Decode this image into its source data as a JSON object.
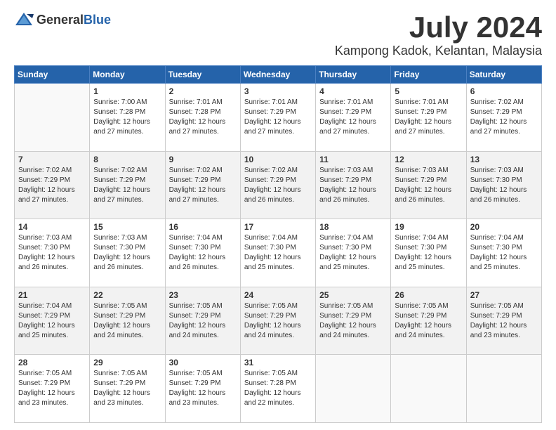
{
  "header": {
    "logo_general": "General",
    "logo_blue": "Blue",
    "month_year": "July 2024",
    "location": "Kampong Kadok, Kelantan, Malaysia"
  },
  "calendar": {
    "days_of_week": [
      "Sunday",
      "Monday",
      "Tuesday",
      "Wednesday",
      "Thursday",
      "Friday",
      "Saturday"
    ],
    "weeks": [
      [
        {
          "day": "",
          "empty": true
        },
        {
          "day": "1",
          "sunrise": "7:00 AM",
          "sunset": "7:28 PM",
          "daylight": "12 hours and 27 minutes."
        },
        {
          "day": "2",
          "sunrise": "7:01 AM",
          "sunset": "7:28 PM",
          "daylight": "12 hours and 27 minutes."
        },
        {
          "day": "3",
          "sunrise": "7:01 AM",
          "sunset": "7:29 PM",
          "daylight": "12 hours and 27 minutes."
        },
        {
          "day": "4",
          "sunrise": "7:01 AM",
          "sunset": "7:29 PM",
          "daylight": "12 hours and 27 minutes."
        },
        {
          "day": "5",
          "sunrise": "7:01 AM",
          "sunset": "7:29 PM",
          "daylight": "12 hours and 27 minutes."
        },
        {
          "day": "6",
          "sunrise": "7:02 AM",
          "sunset": "7:29 PM",
          "daylight": "12 hours and 27 minutes."
        }
      ],
      [
        {
          "day": "7",
          "sunrise": "7:02 AM",
          "sunset": "7:29 PM",
          "daylight": "12 hours and 27 minutes."
        },
        {
          "day": "8",
          "sunrise": "7:02 AM",
          "sunset": "7:29 PM",
          "daylight": "12 hours and 27 minutes."
        },
        {
          "day": "9",
          "sunrise": "7:02 AM",
          "sunset": "7:29 PM",
          "daylight": "12 hours and 27 minutes."
        },
        {
          "day": "10",
          "sunrise": "7:02 AM",
          "sunset": "7:29 PM",
          "daylight": "12 hours and 26 minutes."
        },
        {
          "day": "11",
          "sunrise": "7:03 AM",
          "sunset": "7:29 PM",
          "daylight": "12 hours and 26 minutes."
        },
        {
          "day": "12",
          "sunrise": "7:03 AM",
          "sunset": "7:29 PM",
          "daylight": "12 hours and 26 minutes."
        },
        {
          "day": "13",
          "sunrise": "7:03 AM",
          "sunset": "7:30 PM",
          "daylight": "12 hours and 26 minutes."
        }
      ],
      [
        {
          "day": "14",
          "sunrise": "7:03 AM",
          "sunset": "7:30 PM",
          "daylight": "12 hours and 26 minutes."
        },
        {
          "day": "15",
          "sunrise": "7:03 AM",
          "sunset": "7:30 PM",
          "daylight": "12 hours and 26 minutes."
        },
        {
          "day": "16",
          "sunrise": "7:04 AM",
          "sunset": "7:30 PM",
          "daylight": "12 hours and 26 minutes."
        },
        {
          "day": "17",
          "sunrise": "7:04 AM",
          "sunset": "7:30 PM",
          "daylight": "12 hours and 25 minutes."
        },
        {
          "day": "18",
          "sunrise": "7:04 AM",
          "sunset": "7:30 PM",
          "daylight": "12 hours and 25 minutes."
        },
        {
          "day": "19",
          "sunrise": "7:04 AM",
          "sunset": "7:30 PM",
          "daylight": "12 hours and 25 minutes."
        },
        {
          "day": "20",
          "sunrise": "7:04 AM",
          "sunset": "7:30 PM",
          "daylight": "12 hours and 25 minutes."
        }
      ],
      [
        {
          "day": "21",
          "sunrise": "7:04 AM",
          "sunset": "7:29 PM",
          "daylight": "12 hours and 25 minutes."
        },
        {
          "day": "22",
          "sunrise": "7:05 AM",
          "sunset": "7:29 PM",
          "daylight": "12 hours and 24 minutes."
        },
        {
          "day": "23",
          "sunrise": "7:05 AM",
          "sunset": "7:29 PM",
          "daylight": "12 hours and 24 minutes."
        },
        {
          "day": "24",
          "sunrise": "7:05 AM",
          "sunset": "7:29 PM",
          "daylight": "12 hours and 24 minutes."
        },
        {
          "day": "25",
          "sunrise": "7:05 AM",
          "sunset": "7:29 PM",
          "daylight": "12 hours and 24 minutes."
        },
        {
          "day": "26",
          "sunrise": "7:05 AM",
          "sunset": "7:29 PM",
          "daylight": "12 hours and 24 minutes."
        },
        {
          "day": "27",
          "sunrise": "7:05 AM",
          "sunset": "7:29 PM",
          "daylight": "12 hours and 23 minutes."
        }
      ],
      [
        {
          "day": "28",
          "sunrise": "7:05 AM",
          "sunset": "7:29 PM",
          "daylight": "12 hours and 23 minutes."
        },
        {
          "day": "29",
          "sunrise": "7:05 AM",
          "sunset": "7:29 PM",
          "daylight": "12 hours and 23 minutes."
        },
        {
          "day": "30",
          "sunrise": "7:05 AM",
          "sunset": "7:29 PM",
          "daylight": "12 hours and 23 minutes."
        },
        {
          "day": "31",
          "sunrise": "7:05 AM",
          "sunset": "7:28 PM",
          "daylight": "12 hours and 22 minutes."
        },
        {
          "day": "",
          "empty": true
        },
        {
          "day": "",
          "empty": true
        },
        {
          "day": "",
          "empty": true
        }
      ]
    ]
  }
}
